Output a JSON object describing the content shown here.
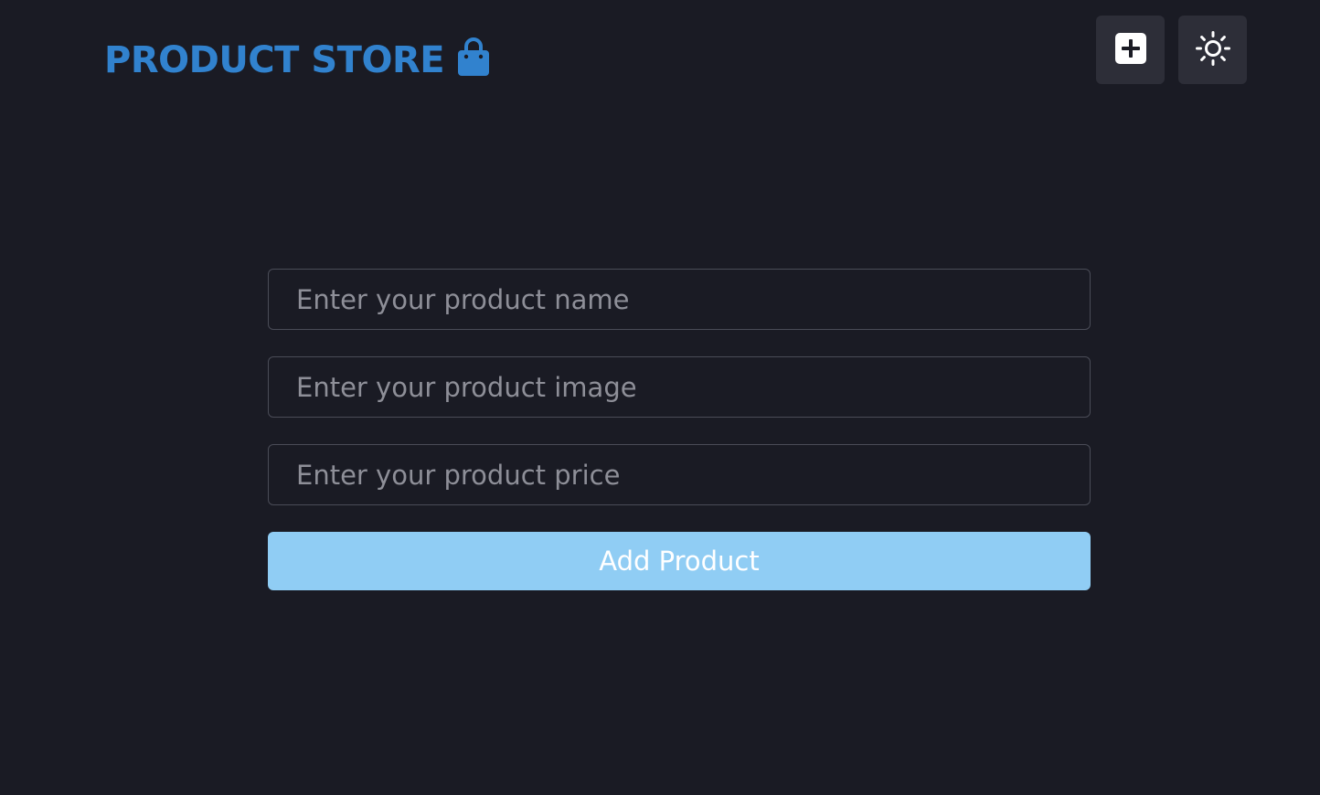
{
  "header": {
    "brand_text": "PRODUCT STORE",
    "brand_icon": "shopping-bag-icon",
    "add_button_icon": "plus-square-icon",
    "theme_button_icon": "sun-icon"
  },
  "form": {
    "name_placeholder": "Enter your product name",
    "image_placeholder": "Enter your product image",
    "price_placeholder": "Enter your product price",
    "name_value": "",
    "image_value": "",
    "price_value": "",
    "submit_label": "Add Product"
  },
  "colors": {
    "background": "#1a1b24",
    "brand": "#3182ce",
    "icon_button_bg": "#2d2e38",
    "submit_bg": "#90cdf4",
    "input_border": "#4a4c57",
    "placeholder": "#8e8f98"
  }
}
